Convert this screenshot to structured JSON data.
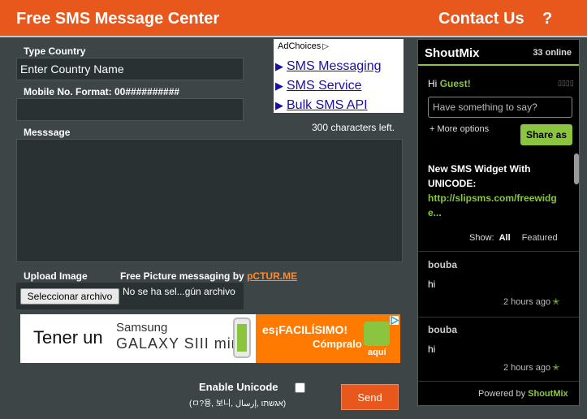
{
  "header": {
    "title": "Free SMS Message Center",
    "contact": "Contact Us",
    "help": "?"
  },
  "form": {
    "country_label": "Type Country",
    "country_placeholder": "Enter Country Name",
    "mobile_label": "Mobile No. Format: 00##########",
    "message_label": "Messsage",
    "chars_left": "300 characters left.",
    "upload_label": "Upload Image",
    "file_button": "Seleccionar archivo",
    "file_status": "No se ha sel...gún archivo",
    "picture_msg_text": "Free Picture messaging by",
    "picture_msg_brand": "pCTUR.ME",
    "unicode_label": "Enable Unicode",
    "unicode_sample": "(ㅁ?용, 보니, אגשתו ,إرسال)",
    "send": "Send"
  },
  "ad_links": {
    "adchoices": "AdChoices",
    "links": [
      "SMS Messaging",
      "SMS Service",
      "Bulk SMS API"
    ]
  },
  "banner": {
    "text1": "Tener un",
    "brand1": "Samsung",
    "brand2": "GALAXY SIII mini",
    "tagline1": "es¡FACILÍSIMO!",
    "tagline2": "Cómpralo",
    "aqui": "aquí"
  },
  "shoutmix": {
    "name": "ShoutMix",
    "online": "33 online",
    "greeting": "Hi",
    "guest": "Guest!",
    "say_placeholder": "Have something to say?",
    "more_options": "+ More options",
    "share_button": "Share as",
    "news_title": "New SMS Widget With UNICODE:",
    "news_link": "http://slipsms.com/freewidge...",
    "show_label": "Show:",
    "show_all": "All",
    "show_featured": "Featured",
    "messages": [
      {
        "user": "bouba",
        "text": "hi",
        "time": "2 hours ago"
      },
      {
        "user": "bouba",
        "text": "hi",
        "time": "2 hours ago"
      }
    ],
    "powered_text": "Powered by",
    "powered_brand": "ShoutMix"
  },
  "colors": {
    "accent": "#e8571c",
    "background": "#3d4547",
    "shoutmix_green": "#8bc53f"
  }
}
